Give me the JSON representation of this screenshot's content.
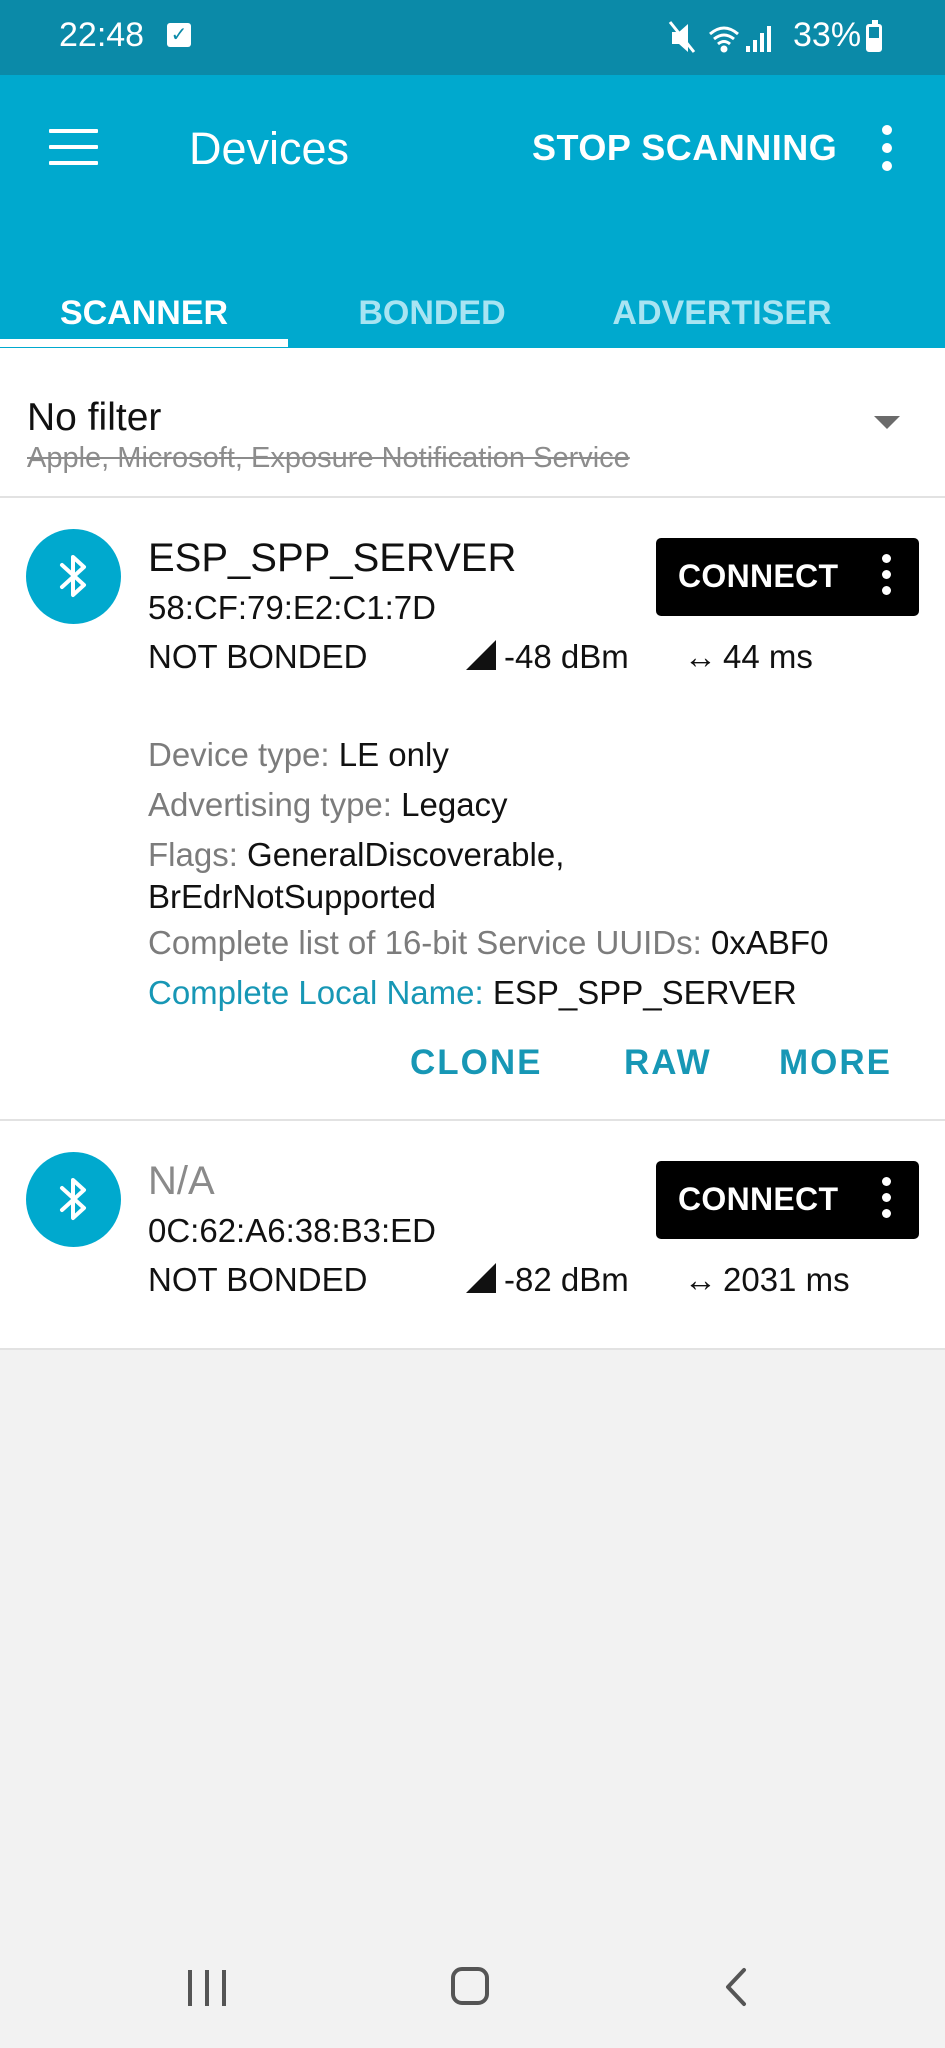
{
  "status_bar": {
    "time": "22:48",
    "battery": "33%",
    "icons": [
      "checkbox-notification-icon",
      "mute-icon",
      "wifi-icon",
      "signal-icon",
      "battery-icon"
    ]
  },
  "app_bar": {
    "title": "Devices",
    "stop_scanning": "STOP SCANNING"
  },
  "tabs": [
    {
      "label": "SCANNER",
      "active": true
    },
    {
      "label": "BONDED",
      "active": false
    },
    {
      "label": "ADVERTISER",
      "active": false
    }
  ],
  "filter": {
    "title": "No filter",
    "subtitle": "Apple, Microsoft, Exposure Notification Service"
  },
  "devices": [
    {
      "name": "ESP_SPP_SERVER",
      "mac": "58:CF:79:E2:C1:7D",
      "bond_state": "NOT BONDED",
      "rssi": "-48 dBm",
      "interval": "44 ms",
      "connect_label": "CONNECT",
      "details": {
        "device_type_key": "Device type:",
        "device_type_value": "LE only",
        "adv_type_key": "Advertising type:",
        "adv_type_value": "Legacy",
        "flags_key": "Flags:",
        "flags_value_line1": "GeneralDiscoverable,",
        "flags_value_line2": "BrEdrNotSupported",
        "uuids_key": "Complete list of 16-bit Service UUIDs:",
        "uuids_value": "0xABF0",
        "local_name_key": "Complete Local Name:",
        "local_name_value": "ESP_SPP_SERVER"
      },
      "actions": {
        "clone": "CLONE",
        "raw": "RAW",
        "more": "MORE"
      }
    },
    {
      "name": "N/A",
      "mac": "0C:62:A6:38:B3:ED",
      "bond_state": "NOT BONDED",
      "rssi": "-82 dBm",
      "interval": "2031 ms",
      "connect_label": "CONNECT"
    }
  ],
  "colors": {
    "status_bar": "#0b8aa8",
    "app_bar": "#00a9ce",
    "accent_text": "#1797b5",
    "connect_button": "#000000",
    "background": "#f2f2f2"
  }
}
